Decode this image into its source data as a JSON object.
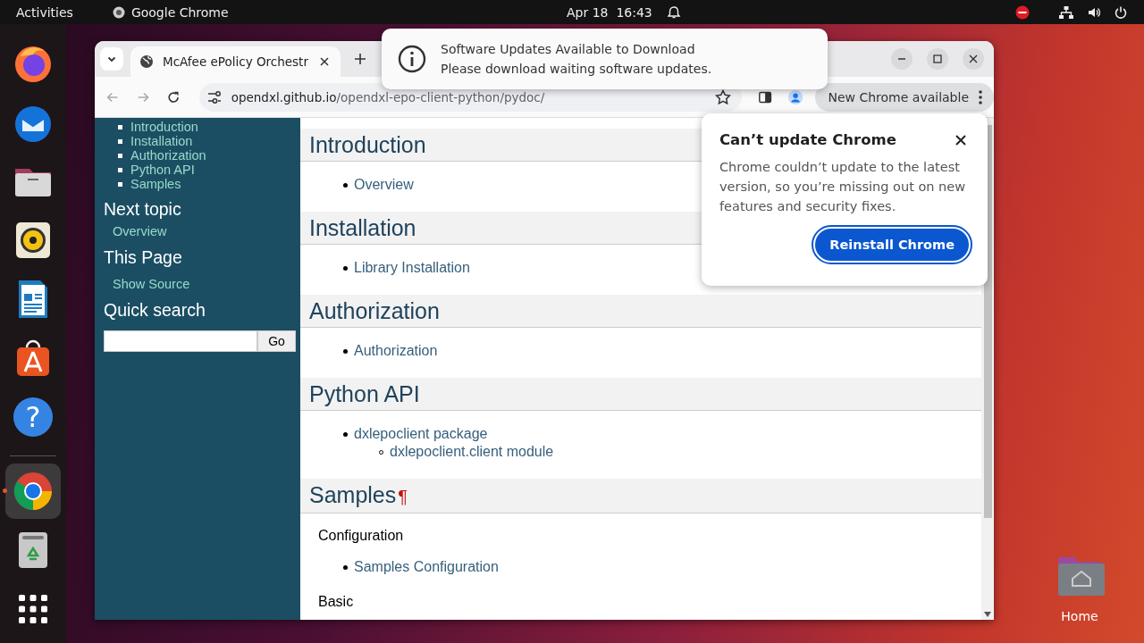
{
  "top_bar": {
    "activities": "Activities",
    "app": "Google Chrome",
    "clock": "Apr 18  16:43"
  },
  "dock": {
    "groups": [
      [
        {
          "kind": "firefox",
          "selected": false,
          "running": false
        },
        {
          "kind": "thunderbird",
          "selected": false,
          "running": false
        },
        {
          "kind": "files",
          "selected": false,
          "running": false
        },
        {
          "kind": "rhythmbox",
          "selected": false,
          "running": false
        },
        {
          "kind": "writer",
          "selected": false,
          "running": false
        },
        {
          "kind": "appcenter",
          "selected": false,
          "running": false
        },
        {
          "kind": "help",
          "glyph": "?",
          "selected": false,
          "running": false
        }
      ],
      [
        {
          "kind": "chrome",
          "selected": true,
          "running": true
        },
        {
          "kind": "trash",
          "selected": false,
          "running": false
        },
        {
          "kind": "apps",
          "selected": false,
          "running": false
        }
      ]
    ]
  },
  "browser": {
    "tab": {
      "title": "McAfee ePolicy Orchestr",
      "selected": true
    },
    "url_host": "opendxl.github.io",
    "url_path": "/opendxl-epo-client-python/pydoc/",
    "update_chip": "New Chrome available"
  },
  "sidebar": {
    "toc": [
      "Introduction",
      "Installation",
      "Authorization",
      "Python API",
      "Samples"
    ],
    "sections": [
      {
        "heading": "Next topic",
        "link": "Overview"
      },
      {
        "heading": "This Page",
        "link": "Show Source"
      }
    ],
    "search": {
      "heading": "Quick search",
      "button": "Go"
    }
  },
  "main": {
    "sections": [
      {
        "heading": "Introduction",
        "blocks": [
          {
            "kind": "list",
            "items": [
              {
                "text": "Overview"
              }
            ]
          }
        ]
      },
      {
        "heading": "Installation",
        "blocks": [
          {
            "kind": "list",
            "items": [
              {
                "text": "Library Installation"
              }
            ]
          }
        ]
      },
      {
        "heading": "Authorization",
        "blocks": [
          {
            "kind": "list",
            "items": [
              {
                "text": "Authorization"
              }
            ]
          }
        ]
      },
      {
        "heading": "Python API",
        "blocks": [
          {
            "kind": "list",
            "items": [
              {
                "text": "dxlepoclient package",
                "children": [
                  {
                    "text": "dxlepoclient.client module"
                  }
                ]
              }
            ]
          }
        ]
      },
      {
        "heading": "Samples",
        "anchor": "¶",
        "blocks": [
          {
            "kind": "paragraph",
            "text": "Configuration"
          },
          {
            "kind": "list",
            "items": [
              {
                "text": "Samples Configuration"
              }
            ]
          },
          {
            "kind": "paragraph",
            "text": "Basic"
          }
        ]
      }
    ]
  },
  "notification": {
    "title": "Software Updates Available to Download",
    "body": "Please download waiting software updates."
  },
  "popup": {
    "title": "Can’t update Chrome",
    "body": "Chrome couldn’t update to the latest version, so you’re missing out on new features and security fixes.",
    "button": "Reinstall Chrome"
  },
  "desktop_icons": [
    {
      "label": "Home"
    }
  ]
}
